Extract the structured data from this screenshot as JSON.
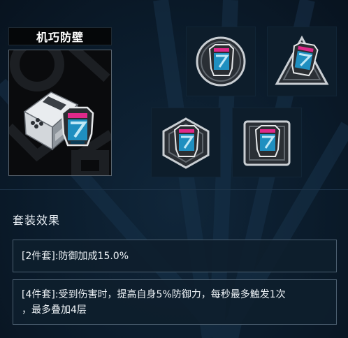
{
  "set": {
    "name": "机巧防壁"
  },
  "pieces": [
    {
      "icon": "round-badge-emblem-icon",
      "frame": "circle"
    },
    {
      "icon": "triangle-badge-emblem-icon",
      "frame": "triangle"
    },
    {
      "icon": "hexagon-badge-emblem-icon",
      "frame": "hexagon"
    },
    {
      "icon": "square-badge-emblem-icon",
      "frame": "square"
    }
  ],
  "effects": {
    "title": "套装效果",
    "two_piece": "[2件套]:防御加成15.0%",
    "four_piece_line1": "[4件套]:受到伤害时，提高自身5%防御力，每秒最多触发1次",
    "four_piece_line2": "，最多叠加4层"
  },
  "colors": {
    "background": "#0b1c2c",
    "emblem_blue": "#1f8fc0",
    "emblem_pink": "#e0298a",
    "panel_border": "#4c5f70"
  }
}
